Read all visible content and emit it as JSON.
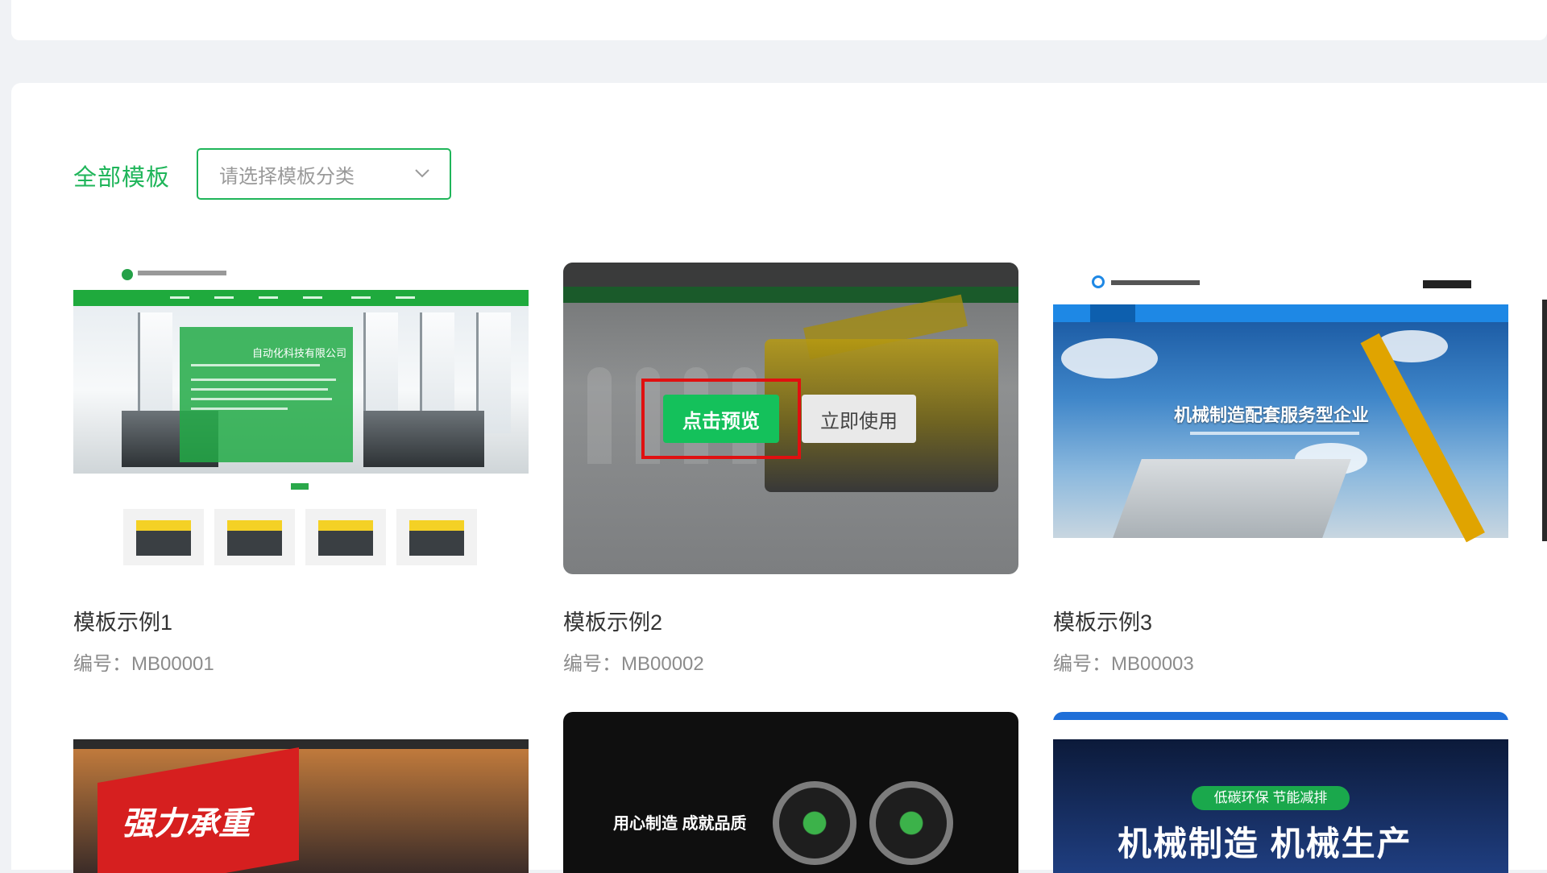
{
  "filter": {
    "label": "全部模板",
    "select_placeholder": "请选择模板分类"
  },
  "colors": {
    "accent": "#1fb55a",
    "highlight": "#e01010"
  },
  "templates": [
    {
      "title": "模板示例1",
      "code": "编号：MB00001",
      "hero_title": "自动化科技有限公司"
    },
    {
      "title": "模板示例2",
      "code": "编号：MB00002",
      "preview_label": "点击预览",
      "use_label": "立即使用"
    },
    {
      "title": "模板示例3",
      "code": "编号：MB00003",
      "hero_title": "机械制造配套服务型企业"
    },
    {
      "hero_title": "强力承重"
    },
    {
      "hero_title": "用心制造 成就品质"
    },
    {
      "badge": "低碳环保 节能减排",
      "hero_title": "机械制造 机械生产"
    }
  ]
}
